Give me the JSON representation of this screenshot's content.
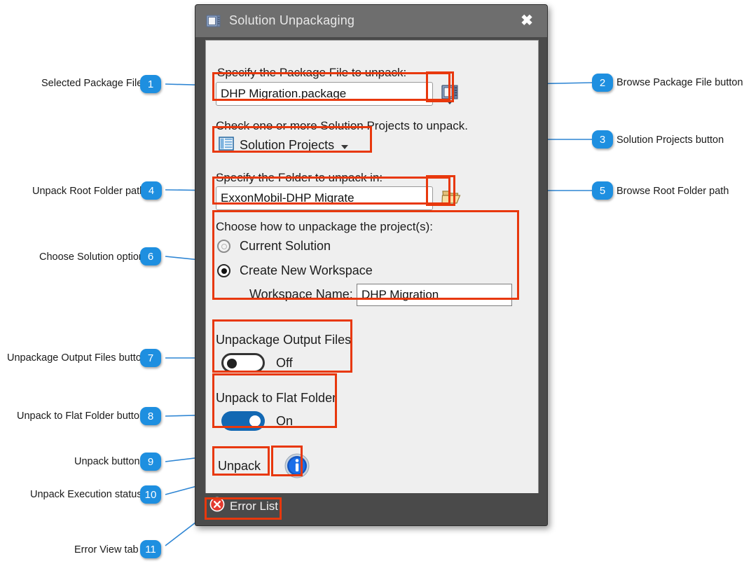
{
  "window": {
    "title": "Solution Unpackaging",
    "icon": "package-icon",
    "close_label": "✖"
  },
  "form": {
    "package_label": "Specify the Package File to unpack:",
    "package_value": "DHP Migration.package",
    "browse_package_icon": "package-browse-icon",
    "projects_label": "Check one or more Solution Projects to unpack.",
    "projects_button": "Solution Projects",
    "projects_icon": "list-grid-icon",
    "folder_label": "Specify the Folder to unpack in:",
    "folder_value": "ExxonMobil-DHP Migrate",
    "browse_folder_icon": "open-folder-icon",
    "choose_label": "Choose how to unpackage the project(s):",
    "option_current": "Current Solution",
    "option_new": "Create New Workspace",
    "selected_option": "Create New Workspace",
    "workspace_label": "Workspace Name:",
    "workspace_value": "DHP Migration",
    "output_files_label": "Unpackage Output Files",
    "output_files_state": "Off",
    "flat_folder_label": "Unpack to Flat Folder",
    "flat_folder_state": "On",
    "unpack_button": "Unpack",
    "info_icon": "info-icon"
  },
  "status": {
    "error_list": "Error List",
    "error_icon": "error-x-icon"
  },
  "colors": {
    "annotation_red": "#e8380d",
    "badge_blue": "#1e8fe0",
    "leader_blue": "#2f86d4",
    "toggle_on": "#1268b3",
    "titlebar": "#6e6e6e",
    "frame": "#4a4a4a"
  },
  "callouts": [
    {
      "num": "1",
      "label": "Selected Package File",
      "side": "left"
    },
    {
      "num": "2",
      "label": "Browse Package File button",
      "side": "right"
    },
    {
      "num": "3",
      "label": "Solution Projects button",
      "side": "right"
    },
    {
      "num": "4",
      "label": "Unpack Root Folder path",
      "side": "left"
    },
    {
      "num": "5",
      "label": "Browse Root Folder path",
      "side": "right"
    },
    {
      "num": "6",
      "label": "Choose Solution option",
      "side": "left"
    },
    {
      "num": "7",
      "label": "Unpackage Output Files button",
      "side": "left"
    },
    {
      "num": "8",
      "label": "Unpack to Flat Folder button",
      "side": "left"
    },
    {
      "num": "9",
      "label": "Unpack button",
      "side": "left"
    },
    {
      "num": "10",
      "label": "Unpack Execution status",
      "side": "left"
    },
    {
      "num": "11",
      "label": "Error View tab",
      "side": "left"
    }
  ]
}
